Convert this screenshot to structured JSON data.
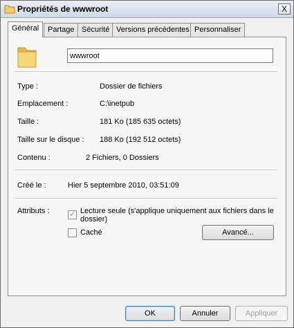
{
  "window": {
    "title": "Propriétés de wwwroot",
    "close_label": "X"
  },
  "tabs": [
    {
      "label": "Général",
      "active": true
    },
    {
      "label": "Partage",
      "active": false
    },
    {
      "label": "Sécurité",
      "active": false
    },
    {
      "label": "Versions précédentes",
      "active": false
    },
    {
      "label": "Personnaliser",
      "active": false
    }
  ],
  "general": {
    "folder_icon": "folder-icon",
    "name_value": "wwwroot",
    "type_label": "Type :",
    "type_value": "Dossier de fichiers",
    "location_label": "Emplacement :",
    "location_value": "C:\\inetpub",
    "size_label": "Taille :",
    "size_value": "181 Ko (185 635 octets)",
    "disk_size_label": "Taille sur le disque :",
    "disk_size_value": "188 Ko (192 512 octets)",
    "contents_label": "Contenu :",
    "contents_value": "2 Fichiers, 0 Dossiers",
    "created_label": "Créé le :",
    "created_value": "Hier 5 septembre 2010, 03:51:09",
    "attributes_label": "Attributs :",
    "readonly_label": "Lecture seule (s'applique uniquement aux fichiers dans le dossier)",
    "readonly_checked": true,
    "hidden_label": "Caché",
    "hidden_checked": false,
    "advanced_label": "Avancé..."
  },
  "footer": {
    "ok_label": "OK",
    "cancel_label": "Annuler",
    "apply_label": "Appliquer"
  },
  "colors": {
    "folder": "#f1cf62",
    "default_button_border": "#3c7fb1"
  }
}
